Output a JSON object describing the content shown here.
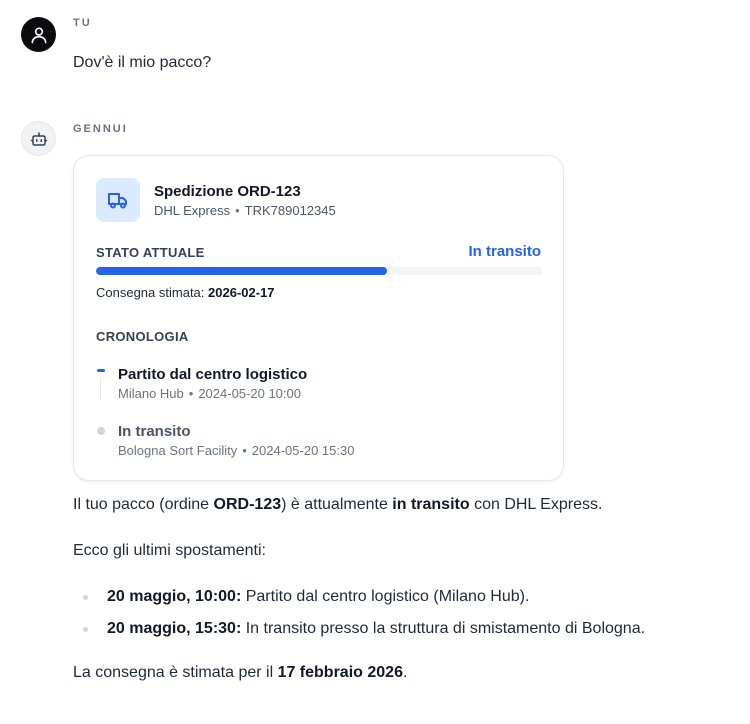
{
  "user_message": {
    "author": "TU",
    "text": "Dov'è il mio pacco?"
  },
  "bot_message": {
    "author": "GENNUI",
    "card": {
      "title": "Spedizione ORD-123",
      "carrier": "DHL Express",
      "separator": "•",
      "tracking": "TRK789012345",
      "status_label": "STATO ATTUALE",
      "status_value": "In transito",
      "progress_fraction": 0.65,
      "accent_color": "#2563eb",
      "eta_label": "Consegna stimata:",
      "eta_value": "2026-02-17",
      "timeline_label": "CRONOLOGIA",
      "events": [
        {
          "title": "Partito dal centro logistico",
          "location": "Milano Hub",
          "time": "2024-05-20 10:00",
          "active": true
        },
        {
          "title": "In transito",
          "location": "Bologna Sort Facility",
          "time": "2024-05-20 15:30",
          "active": false
        }
      ]
    },
    "answer": {
      "p1_a": "Il tuo pacco (ordine ",
      "p1_b": "ORD-123",
      "p1_c": ") è attualmente ",
      "p1_d": "in transito",
      "p1_e": " con DHL Express.",
      "p2": "Ecco gli ultimi spostamenti:",
      "bullets": [
        {
          "bold": "20 maggio, 10:00:",
          "text": " Partito dal centro logistico (Milano Hub)."
        },
        {
          "bold": "20 maggio, 15:30:",
          "text": " In transito presso la struttura di smistamento di Bologna."
        }
      ],
      "p3_a": "La consegna è stimata per il ",
      "p3_b": "17 febbraio 2026",
      "p3_c": "."
    }
  },
  "icons": {
    "user_avatar": "user-icon",
    "bot_avatar": "robot-icon",
    "shipment": "truck-icon"
  }
}
